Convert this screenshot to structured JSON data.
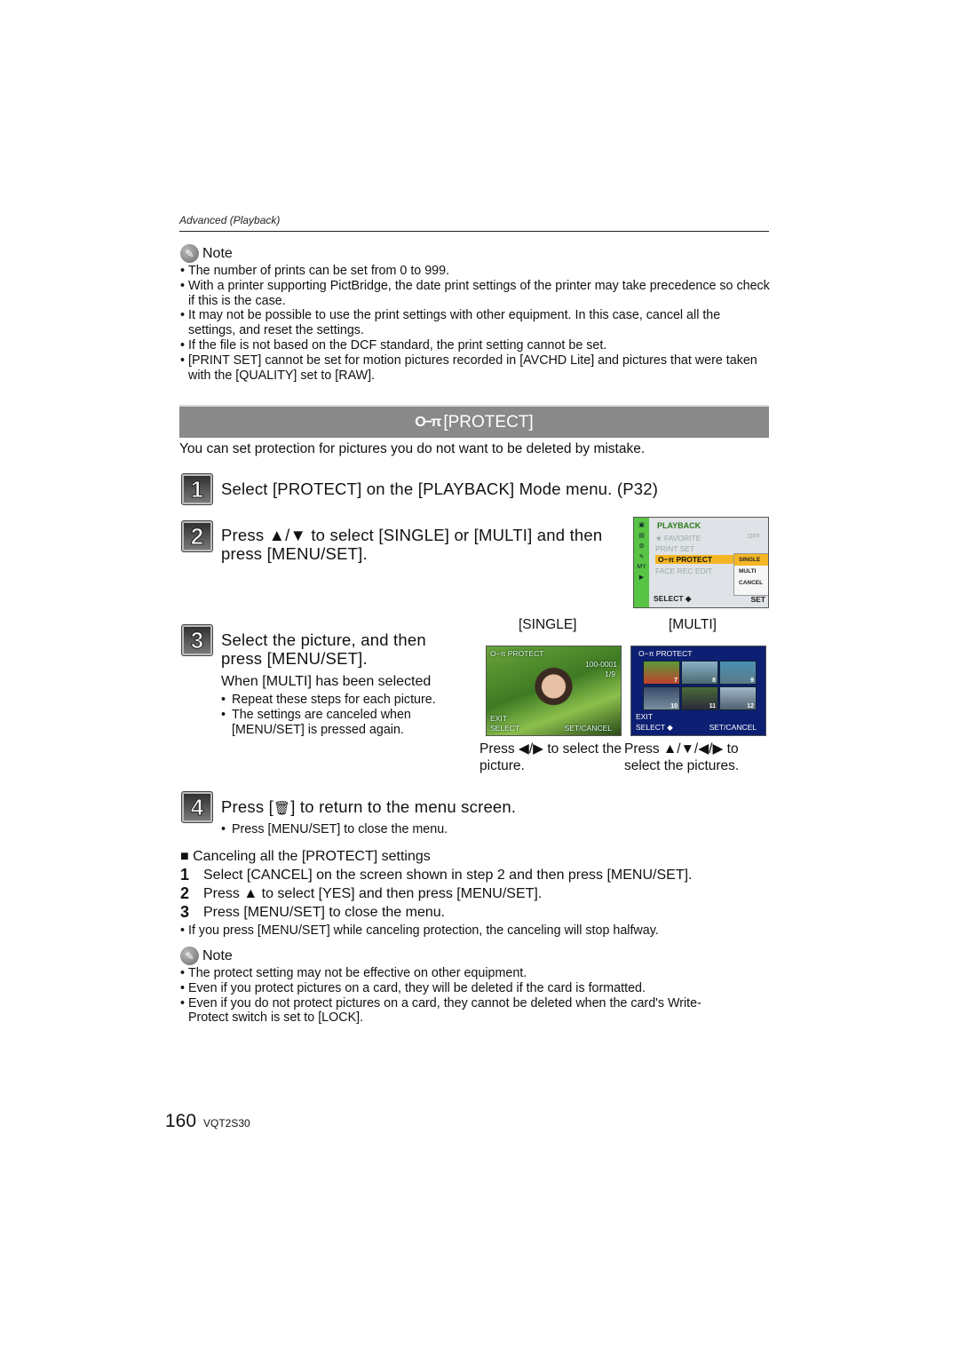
{
  "header": {
    "section_label": "Advanced (Playback)"
  },
  "note1": {
    "heading": "Note",
    "icon": "pencil-icon",
    "items": [
      "The number of prints can be set from 0 to 999.",
      "With a printer supporting PictBridge, the date print settings of the printer may take precedence so check if this is the case.",
      "It may not be possible to use the print settings with other equipment. In this case, cancel all the settings, and reset the settings.",
      "If the file is not based on the DCF standard, the print setting cannot be set.",
      "[PRINT SET] cannot be set for motion pictures recorded in [AVCHD Lite] and pictures that were taken with the [QUALITY] set to [RAW]."
    ]
  },
  "banner": {
    "icon": "key-icon",
    "icon_glyph": "O−π",
    "title": "[PROTECT]"
  },
  "intro": "You can set protection for pictures you do not want to be deleted by mistake.",
  "steps": [
    {
      "number": "1",
      "text": "Select [PROTECT] on the [PLAYBACK] Mode menu. (P32)"
    },
    {
      "number": "2",
      "text": "Press ▲/▼ to select [SINGLE] or [MULTI] and then press [MENU/SET]."
    },
    {
      "number": "3",
      "text": "Select the picture, and then press [MENU/SET].",
      "subheading": "When [MULTI] has been selected",
      "bullets": [
        "Repeat these steps for each picture.",
        "The settings are canceled when [MENU/SET] is pressed again."
      ]
    },
    {
      "number": "4",
      "text_before": "Press [",
      "icon": "trash-icon",
      "icon_glyph": "🗑",
      "text_after": "] to return to the menu screen.",
      "bullets": [
        "Press [MENU/SET] to close the menu."
      ]
    }
  ],
  "menu_screen": {
    "side_icons": [
      "▣",
      "▤",
      "⚙",
      "✎",
      "MY",
      "▶"
    ],
    "title": "PLAYBACK",
    "rows": [
      {
        "label": "★ FAVORITE",
        "value": "OFF",
        "selected": false
      },
      {
        "label": "PRINT SET",
        "value": "",
        "selected": false
      },
      {
        "label": "O−π PROTECT",
        "value": "",
        "selected": true
      },
      {
        "label": "FACE REC EDIT",
        "value": "",
        "selected": false
      }
    ],
    "submenu": [
      {
        "label": "SINGLE",
        "selected": true
      },
      {
        "label": "MULTI",
        "selected": false
      },
      {
        "label": "CANCEL",
        "selected": false
      }
    ],
    "footer_left": "SELECT ◆",
    "footer_right": "SET"
  },
  "screens": {
    "single": {
      "label": "[SINGLE]",
      "title": "O−π PROTECT",
      "file": "100-0001",
      "count": "1/9",
      "exit": "EXIT",
      "select": "SELECT",
      "set": "SET/CANCEL",
      "caption": "Press ◀/▶ to select the picture."
    },
    "multi": {
      "label": "[MULTI]",
      "title": "O−π PROTECT",
      "thumbs": [
        "7",
        "8",
        "9",
        "10",
        "11",
        "12"
      ],
      "exit": "EXIT",
      "select": "SELECT ◆",
      "set": "SET/CANCEL",
      "caption": "Press ▲/▼/◀/▶ to select the pictures."
    }
  },
  "cancel_section": {
    "heading": "■ Canceling all the [PROTECT] settings",
    "steps": [
      {
        "number": "1",
        "text": "Select [CANCEL] on the screen shown in step 2 and then press [MENU/SET]."
      },
      {
        "number": "2",
        "text": "Press ▲ to select [YES] and then press [MENU/SET]."
      },
      {
        "number": "3",
        "text": "Press [MENU/SET] to close the menu."
      }
    ],
    "bullet": "If you press [MENU/SET] while canceling protection, the canceling will stop halfway."
  },
  "note2": {
    "heading": "Note",
    "icon": "pencil-icon",
    "items": [
      "The protect setting may not be effective on other equipment.",
      "Even if you protect pictures on a card, they will be deleted if the card is formatted.",
      "Even if you do not protect pictures on a card, they cannot be deleted when the card's Write-Protect switch is set to [LOCK]."
    ]
  },
  "footer": {
    "page_number": "160",
    "doc_code": "VQT2S30"
  }
}
